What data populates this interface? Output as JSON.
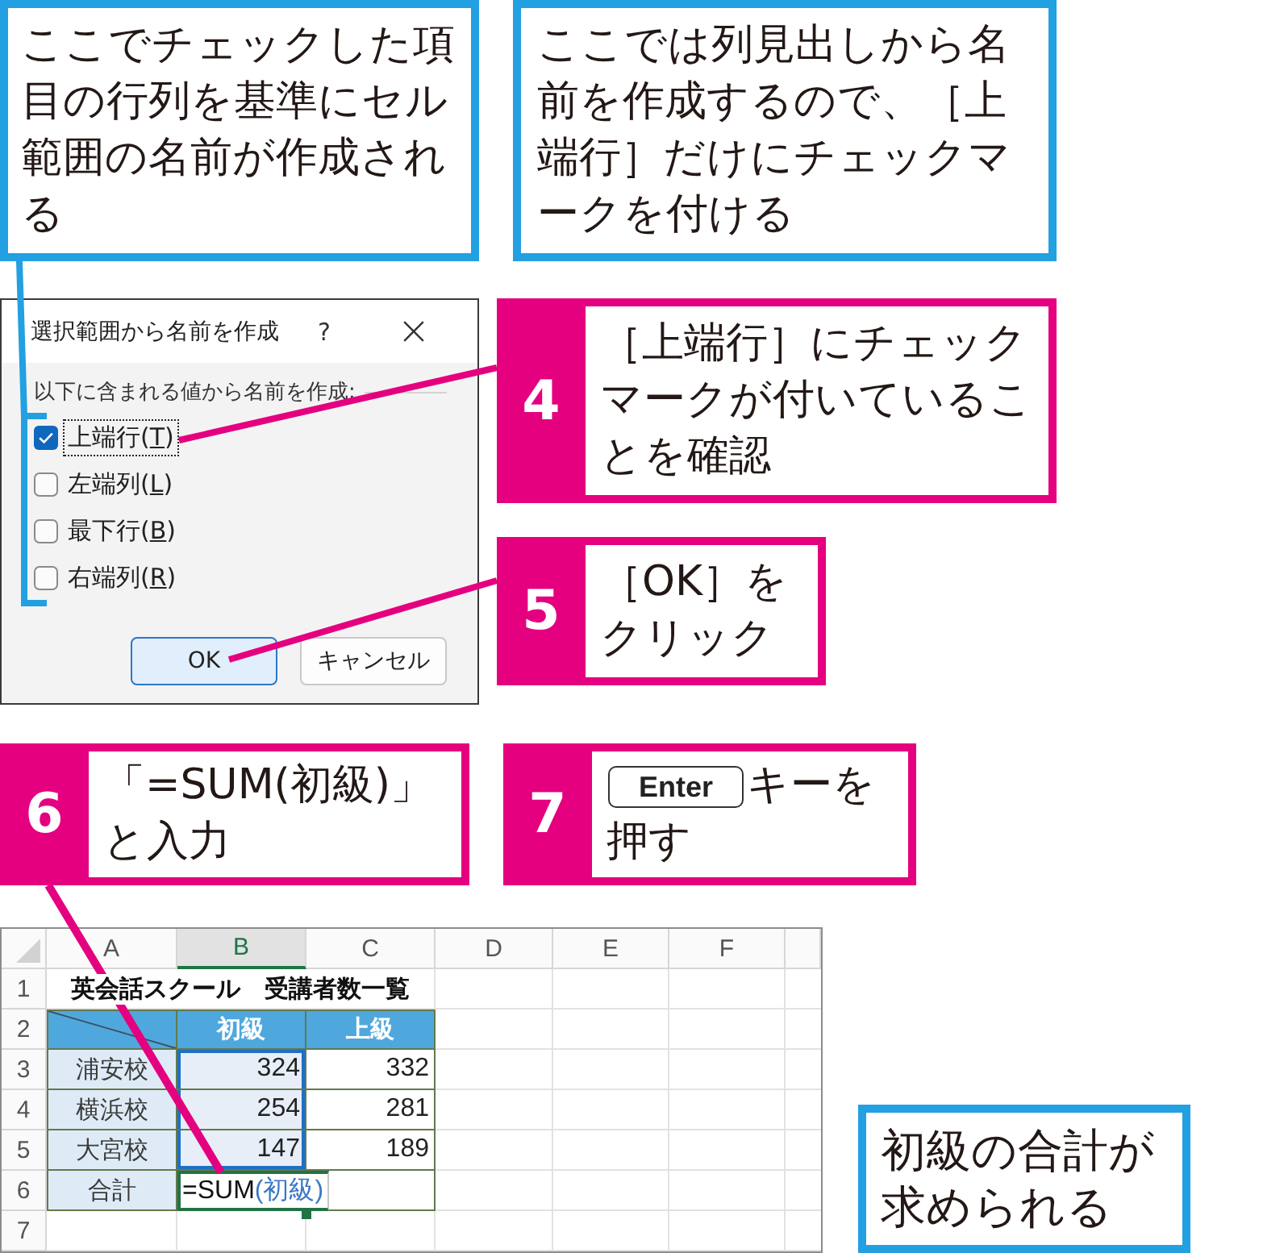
{
  "top_notes": [
    {
      "text": "ここでチェックした項目の行列を基準にセル範囲の名前が作成される"
    },
    {
      "text": "ここでは列見出しから名前を作成するので、［上端行］だけにチェックマークを付ける"
    }
  ],
  "dialog": {
    "title": "選択範囲から名前を作成",
    "help": "?",
    "group_label": "以下に含まれる値から名前を作成:",
    "options": [
      {
        "label": "上端行(",
        "access_key": "T",
        "label_end": ")",
        "checked": true,
        "focused": true
      },
      {
        "label": "左端列(",
        "access_key": "L",
        "label_end": ")",
        "checked": false,
        "focused": false
      },
      {
        "label": "最下行(",
        "access_key": "B",
        "label_end": ")",
        "checked": false,
        "focused": false
      },
      {
        "label": "右端列(",
        "access_key": "R",
        "label_end": ")",
        "checked": false,
        "focused": false
      }
    ],
    "buttons": [
      {
        "label": "OK",
        "default": true
      },
      {
        "label": "キャンセル",
        "default": false
      }
    ]
  },
  "steps": [
    {
      "number": "4",
      "text": "［上端行］にチェックマークが付いていることを確認"
    },
    {
      "number": "5",
      "text": "［OK］をクリック"
    },
    {
      "number": "6",
      "text": "「=SUM(初級)」と入力"
    },
    {
      "number": "7",
      "key": "Enter",
      "text": "キーを押す"
    }
  ],
  "spreadsheet": {
    "columns": [
      {
        "label": "A",
        "selected": false
      },
      {
        "label": "B",
        "selected": true
      },
      {
        "label": "C",
        "selected": false
      },
      {
        "label": "D",
        "selected": false
      },
      {
        "label": "E",
        "selected": false
      },
      {
        "label": "F",
        "selected": false
      }
    ],
    "rows": [
      {
        "number": "1",
        "cells": [
          {
            "kind": "title",
            "text": "英会話スクール　受講者数一覧"
          }
        ]
      },
      {
        "number": "2",
        "cells": [
          {
            "kind": "corner",
            "highlighted": false
          },
          {
            "kind": "header",
            "text": "初級",
            "highlighted": false
          },
          {
            "kind": "header",
            "text": "上級",
            "highlighted": false
          }
        ]
      },
      {
        "number": "3",
        "cells": [
          {
            "kind": "label",
            "text": "浦安校",
            "highlighted": false
          },
          {
            "kind": "value",
            "text": "324",
            "highlighted": true
          },
          {
            "kind": "value",
            "text": "332",
            "highlighted": false
          }
        ]
      },
      {
        "number": "4",
        "cells": [
          {
            "kind": "label",
            "text": "横浜校",
            "highlighted": false
          },
          {
            "kind": "value",
            "text": "254",
            "highlighted": true
          },
          {
            "kind": "value",
            "text": "281",
            "highlighted": false
          }
        ]
      },
      {
        "number": "5",
        "cells": [
          {
            "kind": "label",
            "text": "大宮校",
            "highlighted": false
          },
          {
            "kind": "value",
            "text": "147",
            "highlighted": true
          },
          {
            "kind": "value",
            "text": "189",
            "highlighted": false
          }
        ]
      },
      {
        "number": "6",
        "cells": [
          {
            "kind": "label",
            "text": "合計",
            "highlighted": false
          },
          {
            "kind": "formula",
            "text": "=SUM",
            "reference": "(初級)",
            "highlighted": false
          },
          {
            "kind": "value",
            "highlighted": false
          }
        ]
      },
      {
        "number": "7"
      }
    ]
  },
  "result_note": {
    "text": "初級の合計が求められる"
  }
}
